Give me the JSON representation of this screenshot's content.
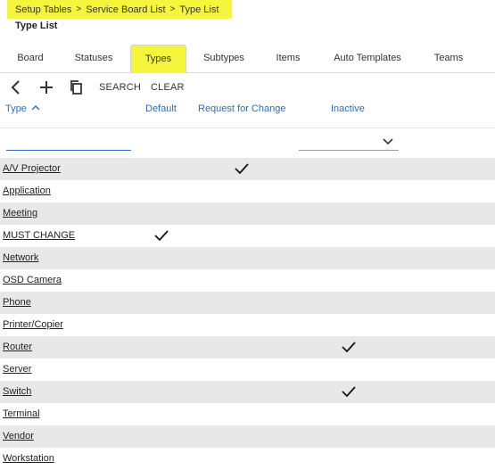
{
  "breadcrumb": {
    "items": [
      "Setup Tables",
      "Service Board List",
      "Type List"
    ]
  },
  "page_title": "Type List",
  "tabs": [
    {
      "label": "Board",
      "active": false
    },
    {
      "label": "Statuses",
      "active": false
    },
    {
      "label": "Types",
      "active": true
    },
    {
      "label": "Subtypes",
      "active": false
    },
    {
      "label": "Items",
      "active": false
    },
    {
      "label": "Auto Templates",
      "active": false
    },
    {
      "label": "Teams",
      "active": false
    }
  ],
  "toolbar": {
    "search_label": "SEARCH",
    "clear_label": "CLEAR"
  },
  "columns": {
    "type": "Type",
    "default": "Default",
    "request_for_change": "Request for Change",
    "inactive": "Inactive"
  },
  "filters": {
    "type_value": "",
    "inactive_value": ""
  },
  "rows": [
    {
      "type": "A/V Projector",
      "default": false,
      "request_for_change": true,
      "inactive": false
    },
    {
      "type": "Application",
      "default": false,
      "request_for_change": false,
      "inactive": false
    },
    {
      "type": "Meeting",
      "default": false,
      "request_for_change": false,
      "inactive": false
    },
    {
      "type": "MUST CHANGE",
      "default": true,
      "request_for_change": false,
      "inactive": false
    },
    {
      "type": "Network",
      "default": false,
      "request_for_change": false,
      "inactive": false
    },
    {
      "type": "OSD Camera",
      "default": false,
      "request_for_change": false,
      "inactive": false
    },
    {
      "type": "Phone",
      "default": false,
      "request_for_change": false,
      "inactive": false
    },
    {
      "type": "Printer/Copier",
      "default": false,
      "request_for_change": false,
      "inactive": false
    },
    {
      "type": "Router",
      "default": false,
      "request_for_change": false,
      "inactive": true
    },
    {
      "type": "Server",
      "default": false,
      "request_for_change": false,
      "inactive": false
    },
    {
      "type": "Switch",
      "default": false,
      "request_for_change": false,
      "inactive": true
    },
    {
      "type": "Terminal",
      "default": false,
      "request_for_change": false,
      "inactive": false
    },
    {
      "type": "Vendor",
      "default": false,
      "request_for_change": false,
      "inactive": false
    },
    {
      "type": "Workstation",
      "default": false,
      "request_for_change": false,
      "inactive": false
    }
  ],
  "colors": {
    "highlight": "#f5f53b",
    "link_blue": "#2a6ebb",
    "row_alt": "#e8e8e8"
  },
  "icons": {
    "back": "chevron-left-icon",
    "add": "plus-icon",
    "copy": "copy-icon",
    "sort": "sort-ascending-icon",
    "dropdown": "chevron-down-icon",
    "check": "checkmark-icon"
  }
}
